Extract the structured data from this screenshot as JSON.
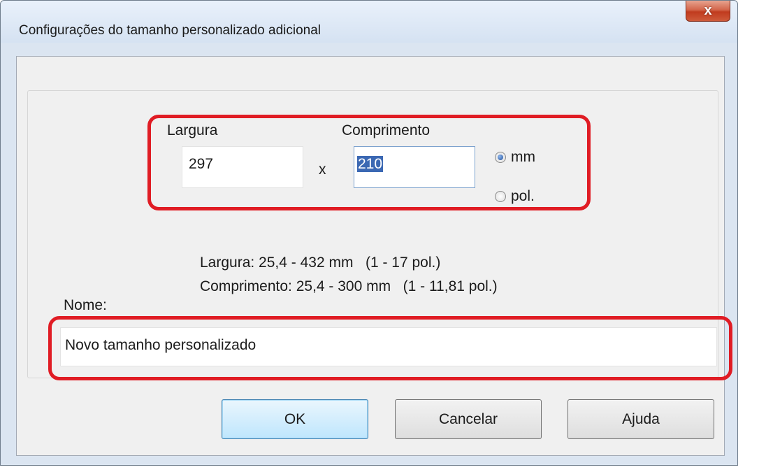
{
  "window": {
    "title": "Configurações do tamanho personalizado adicional",
    "close_glyph": "x"
  },
  "size": {
    "width_label": "Largura",
    "width_value": "297",
    "separator": "x",
    "length_label": "Comprimento",
    "length_value": "210",
    "unit_mm": "mm",
    "unit_in": "pol.",
    "selected_unit": "mm"
  },
  "ranges": {
    "width_range": "Largura: 25,4 - 432 mm   (1 - 17 pol.)",
    "length_range": "Comprimento: 25,4 - 300 mm   (1 - 11,81 pol.)"
  },
  "name": {
    "label": "Nome:",
    "value": "Novo tamanho personalizado"
  },
  "buttons": {
    "ok": "OK",
    "cancel": "Cancelar",
    "help": "Ajuda"
  },
  "colors": {
    "highlight": "#e01c24",
    "selection": "#3b68b3",
    "close_button": "#c03b1e"
  }
}
